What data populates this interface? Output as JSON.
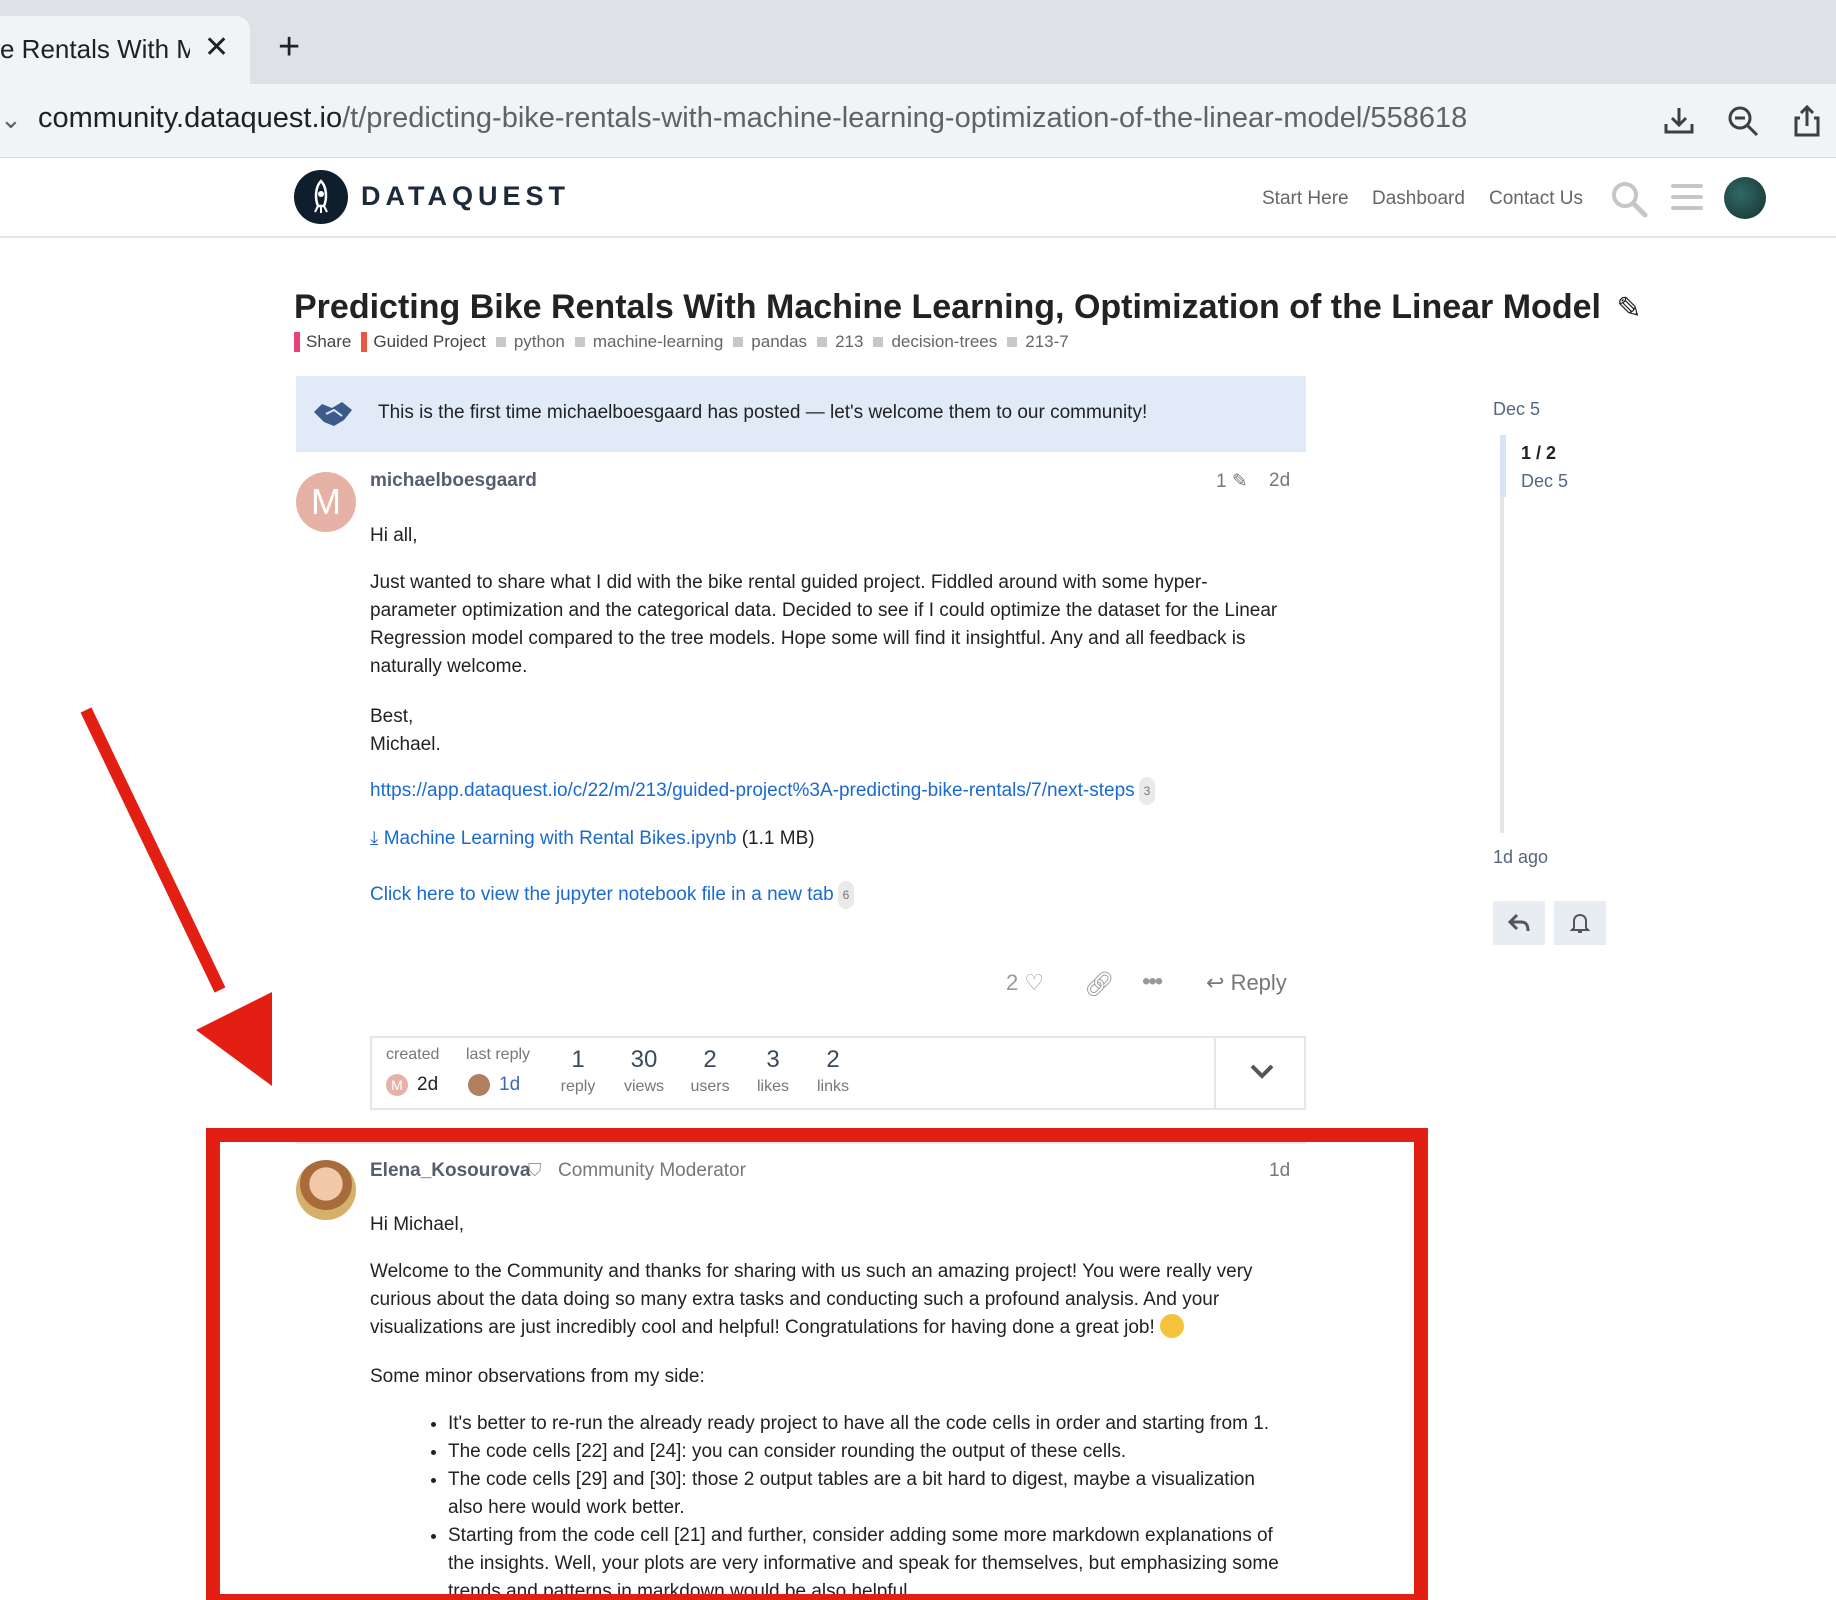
{
  "browser": {
    "tab_title": "e Rentals With M",
    "url_host": "community.dataquest.io",
    "url_path": "/t/predicting-bike-rentals-with-machine-learning-optimization-of-the-linear-model/558618"
  },
  "site": {
    "logo_text": "DATAQUEST",
    "nav": [
      "Start Here",
      "Dashboard",
      "Contact Us"
    ]
  },
  "topic": {
    "title": "Predicting Bike Rentals With Machine Learning, Optimization of the Linear Model",
    "categories": [
      {
        "label": "Share",
        "color": "#e8407a"
      },
      {
        "label": "Guided Project",
        "color": "#e9573f"
      }
    ],
    "tags": [
      "python",
      "machine-learning",
      "pandas",
      "213",
      "decision-trees",
      "213-7"
    ]
  },
  "welcome_banner": "This is the first time michaelboesgaard has posted — let's welcome them to our community!",
  "post1": {
    "avatar_letter": "M",
    "username": "michaelboesgaard",
    "edit_count": "1",
    "age": "2d",
    "greeting": "Hi all,",
    "paragraph": "Just wanted to share what I did with the bike rental guided project. Fiddled around with some hyper-parameter optimization and the categorical data. Decided to see if I could optimize the dataset for the Linear Regression model compared to the tree models. Hope some will find it insightful. Any and all feedback is naturally welcome.",
    "signoff1": "Best,",
    "signoff2": "Michael.",
    "link1": "https://app.dataquest.io/c/22/m/213/guided-project%3A-predicting-bike-rentals/7/next-steps",
    "link1_count": "3",
    "attachment_name": "Machine Learning with Rental Bikes.ipynb",
    "attachment_size": "(1.1 MB)",
    "link2": "Click here to view the jupyter notebook file in a new tab",
    "link2_count": "6",
    "likes": "2",
    "reply_label": "Reply"
  },
  "topic_map": {
    "created_label": "created",
    "created_age": "2d",
    "last_reply_label": "last reply",
    "last_reply_age": "1d",
    "stats": [
      {
        "num": "1",
        "label": "reply"
      },
      {
        "num": "30",
        "label": "views"
      },
      {
        "num": "2",
        "label": "users"
      },
      {
        "num": "3",
        "label": "likes"
      },
      {
        "num": "2",
        "label": "links"
      }
    ]
  },
  "post2": {
    "username": "Elena_Kosourova",
    "title": "Community Moderator",
    "age": "1d",
    "greeting": "Hi Michael,",
    "paragraph": "Welcome to the Community and thanks for sharing with us such an amazing project! You were really very curious about the data doing so many extra tasks and conducting such a profound analysis. And your visualizations are just incredibly cool and helpful! Congratulations for having done a great job!",
    "observations_intro": "Some minor observations from my side:",
    "bullets": [
      "It's better to re-run the already ready project to have all the code cells in order and starting from 1.",
      "The code cells [22] and [24]: you can consider rounding the output of these cells.",
      "The code cells [29] and [30]: those 2 output tables are a bit hard to digest, maybe a visualization also here would work better.",
      "Starting from the code cell [21] and further, consider adding some more markdown explanations of the insights. Well, your plots are very informative and speak for themselves, but emphasizing some trends and patterns in markdown would be also helpful."
    ]
  },
  "timeline": {
    "top_date": "Dec 5",
    "position": "1 / 2",
    "position_date": "Dec 5",
    "bottom": "1d ago"
  },
  "colors": {
    "annotation_red": "#e31e12",
    "link_blue": "#1a6ad0",
    "banner_bg": "#e1ebf7"
  }
}
